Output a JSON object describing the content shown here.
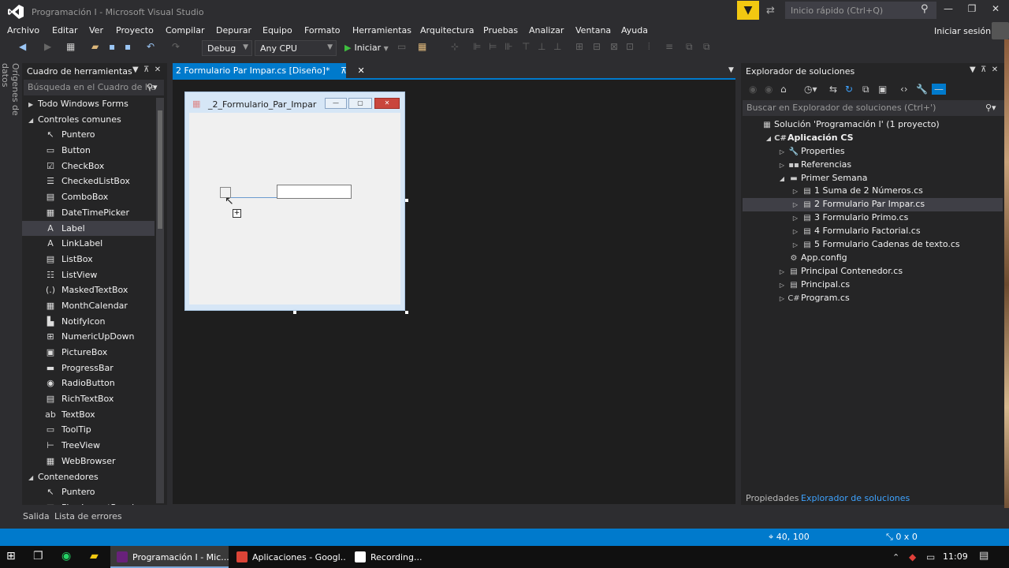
{
  "window": {
    "title": "Programación I - Microsoft Visual Studio"
  },
  "titlebar": {
    "quick_launch_placeholder": "Inicio rápido (Ctrl+Q)",
    "minimize": "—",
    "maximize": "❐",
    "close": "✕"
  },
  "menu": [
    "Archivo",
    "Editar",
    "Ver",
    "Proyecto",
    "Compilar",
    "Depurar",
    "Equipo",
    "Formato",
    "Herramientas",
    "Arquitectura",
    "Pruebas",
    "Analizar",
    "Ventana",
    "Ayuda"
  ],
  "account": {
    "sign_in": "Iniciar sesión"
  },
  "toolbar": {
    "config": "Debug",
    "platform": "Any CPU",
    "start": "Iniciar"
  },
  "side_tab": "Orígenes de datos",
  "toolbox": {
    "title": "Cuadro de herramientas",
    "search_placeholder": "Búsqueda en el Cuadro de he",
    "items": [
      {
        "kind": "cat",
        "label": "Todo Windows Forms",
        "tri": "▶"
      },
      {
        "kind": "cat",
        "label": "Controles comunes",
        "tri": "◢"
      },
      {
        "kind": "item",
        "label": "Puntero",
        "icon": "↖"
      },
      {
        "kind": "item",
        "label": "Button",
        "icon": "▭"
      },
      {
        "kind": "item",
        "label": "CheckBox",
        "icon": "☑"
      },
      {
        "kind": "item",
        "label": "CheckedListBox",
        "icon": "☰"
      },
      {
        "kind": "item",
        "label": "ComboBox",
        "icon": "▤"
      },
      {
        "kind": "item",
        "label": "DateTimePicker",
        "icon": "▦"
      },
      {
        "kind": "item",
        "label": "Label",
        "icon": "A",
        "selected": true
      },
      {
        "kind": "item",
        "label": "LinkLabel",
        "icon": "A"
      },
      {
        "kind": "item",
        "label": "ListBox",
        "icon": "▤"
      },
      {
        "kind": "item",
        "label": "ListView",
        "icon": "☷"
      },
      {
        "kind": "item",
        "label": "MaskedTextBox",
        "icon": "(.)"
      },
      {
        "kind": "item",
        "label": "MonthCalendar",
        "icon": "▦"
      },
      {
        "kind": "item",
        "label": "NotifyIcon",
        "icon": "▙"
      },
      {
        "kind": "item",
        "label": "NumericUpDown",
        "icon": "⊞"
      },
      {
        "kind": "item",
        "label": "PictureBox",
        "icon": "▣"
      },
      {
        "kind": "item",
        "label": "ProgressBar",
        "icon": "▬"
      },
      {
        "kind": "item",
        "label": "RadioButton",
        "icon": "◉"
      },
      {
        "kind": "item",
        "label": "RichTextBox",
        "icon": "▤"
      },
      {
        "kind": "item",
        "label": "TextBox",
        "icon": "ab"
      },
      {
        "kind": "item",
        "label": "ToolTip",
        "icon": "▭"
      },
      {
        "kind": "item",
        "label": "TreeView",
        "icon": "⊢"
      },
      {
        "kind": "item",
        "label": "WebBrowser",
        "icon": "▦"
      },
      {
        "kind": "cat",
        "label": "Contenedores",
        "tri": "◢"
      },
      {
        "kind": "item",
        "label": "Puntero",
        "icon": "↖"
      },
      {
        "kind": "item",
        "label": "FlowLayoutPanel",
        "icon": "▦"
      }
    ]
  },
  "document": {
    "tab_label": "2 Formulario Par Impar.cs [Diseño]*",
    "pin": "⊼",
    "close": "✕"
  },
  "form": {
    "title": "_2_Formulario_Par_Impar",
    "min": "—",
    "max": "▢",
    "close": "✕"
  },
  "solution_explorer": {
    "title": "Explorador de soluciones",
    "search_placeholder": "Buscar en Explorador de soluciones (Ctrl+')",
    "tree": [
      {
        "label": "Solución 'Programación I' (1 proyecto)",
        "indent": 0,
        "tri": "",
        "icon": "▦"
      },
      {
        "label": "Aplicación CS",
        "indent": 1,
        "tri": "◢",
        "icon": "C#",
        "bold": true
      },
      {
        "label": "Properties",
        "indent": 2,
        "tri": "▷",
        "icon": "🔧"
      },
      {
        "label": "Referencias",
        "indent": 2,
        "tri": "▷",
        "icon": "▪▪"
      },
      {
        "label": "Primer Semana",
        "indent": 2,
        "tri": "◢",
        "icon": "▬"
      },
      {
        "label": "1 Suma de 2 Números.cs",
        "indent": 3,
        "tri": "▷",
        "icon": "▤"
      },
      {
        "label": "2 Formulario Par Impar.cs",
        "indent": 3,
        "tri": "▷",
        "icon": "▤",
        "selected": true
      },
      {
        "label": "3 Formulario Primo.cs",
        "indent": 3,
        "tri": "▷",
        "icon": "▤"
      },
      {
        "label": "4 Formulario Factorial.cs",
        "indent": 3,
        "tri": "▷",
        "icon": "▤"
      },
      {
        "label": "5 Formulario Cadenas de texto.cs",
        "indent": 3,
        "tri": "▷",
        "icon": "▤"
      },
      {
        "label": "App.config",
        "indent": 2,
        "tri": "",
        "icon": "⚙"
      },
      {
        "label": "Principal Contenedor.cs",
        "indent": 2,
        "tri": "▷",
        "icon": "▤"
      },
      {
        "label": "Principal.cs",
        "indent": 2,
        "tri": "▷",
        "icon": "▤"
      },
      {
        "label": "Program.cs",
        "indent": 2,
        "tri": "▷",
        "icon": "C#"
      }
    ],
    "tabs": {
      "properties": "Propiedades",
      "solution": "Explorador de soluciones"
    }
  },
  "bottom_tabs": {
    "output": "Salida",
    "errors": "Lista de errores"
  },
  "status": {
    "position": "40, 100",
    "size": "0 x 0"
  },
  "taskbar": {
    "apps": [
      {
        "label": "Programación I - Mic...",
        "color": "#68217a",
        "active": true
      },
      {
        "label": "Aplicaciones - Googl...",
        "color": "#db4437",
        "active": false
      },
      {
        "label": "Recording...",
        "color": "#ffffff",
        "active": false
      }
    ],
    "time": "11:09"
  },
  "colors": {
    "accent": "#007acc",
    "background": "#2d2d30",
    "panel": "#252526",
    "editor": "#1e1e1e"
  }
}
